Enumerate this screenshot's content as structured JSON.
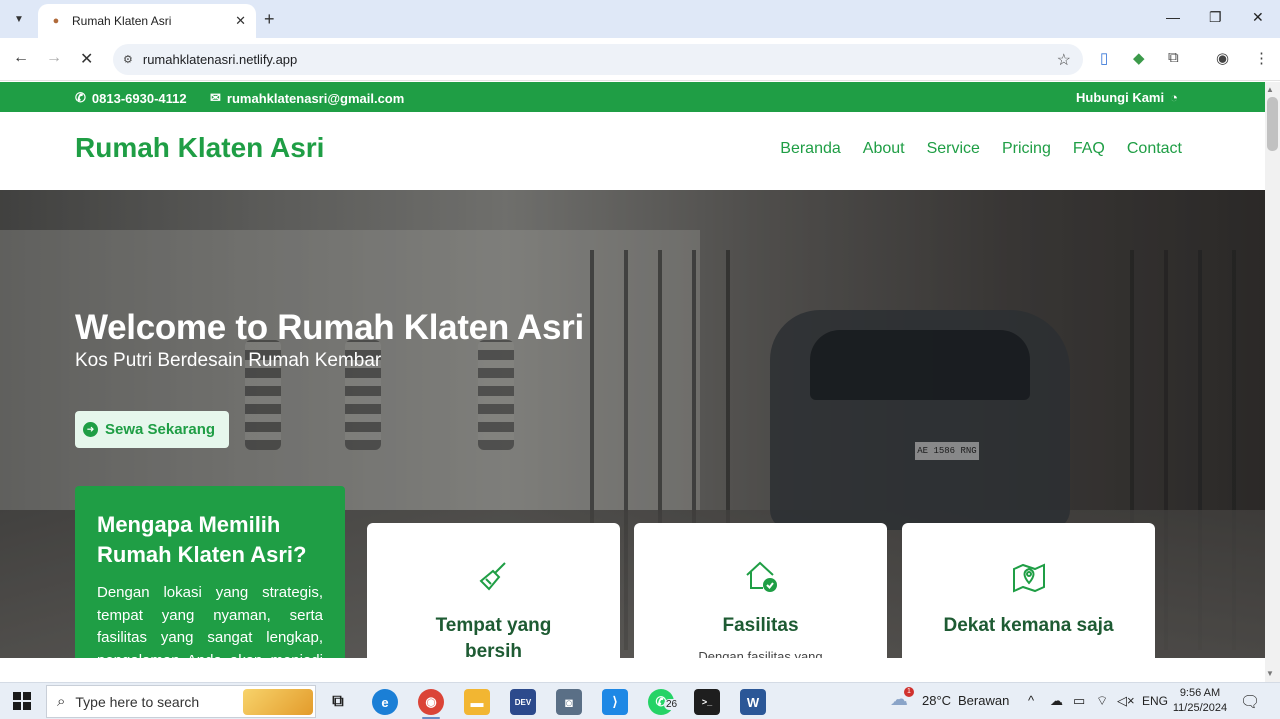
{
  "browser": {
    "tab_title": "Rumah Klaten Asri",
    "url": "rumahklatenasri.netlify.app"
  },
  "site": {
    "topbar": {
      "phone": "0813-6930-4112",
      "email": "rumahklatenasri@gmail.com",
      "contact_link": "Hubungi Kami"
    },
    "logo": "Rumah Klaten Asri",
    "menu": [
      "Beranda",
      "About",
      "Service",
      "Pricing",
      "FAQ",
      "Contact"
    ],
    "hero": {
      "title": "Welcome to Rumah Klaten Asri",
      "subtitle": "Kos Putri Berdesain Rumah Kembar",
      "cta": "Sewa Sekarang",
      "plate_text": "AE 1586 RNG"
    },
    "why": {
      "title": "Mengapa Memilih Rumah Klaten Asri?",
      "text": "Dengan lokasi yang strategis, tempat yang nyaman, serta fasilitas yang sangat lengkap, pengalaman Anda akan menjadi lebih"
    },
    "cards": [
      {
        "title": "Tempat yang bersih",
        "text": "",
        "icon": "broom-icon"
      },
      {
        "title": "Fasilitas",
        "text": "Dengan fasilitas yang",
        "icon": "house-check-icon"
      },
      {
        "title": "Dekat kemana saja",
        "text": "",
        "icon": "map-pin-icon"
      }
    ]
  },
  "taskbar": {
    "search_placeholder": "Type here to search",
    "whatsapp_badge": "26",
    "weather_temp": "28°C",
    "weather_desc": "Berawan",
    "weather_alert": "1",
    "language": "ENG",
    "time": "9:56 AM",
    "date": "11/25/2024"
  },
  "colors": {
    "brand_green": "#1f9e45",
    "card_title": "#1e5b33"
  }
}
